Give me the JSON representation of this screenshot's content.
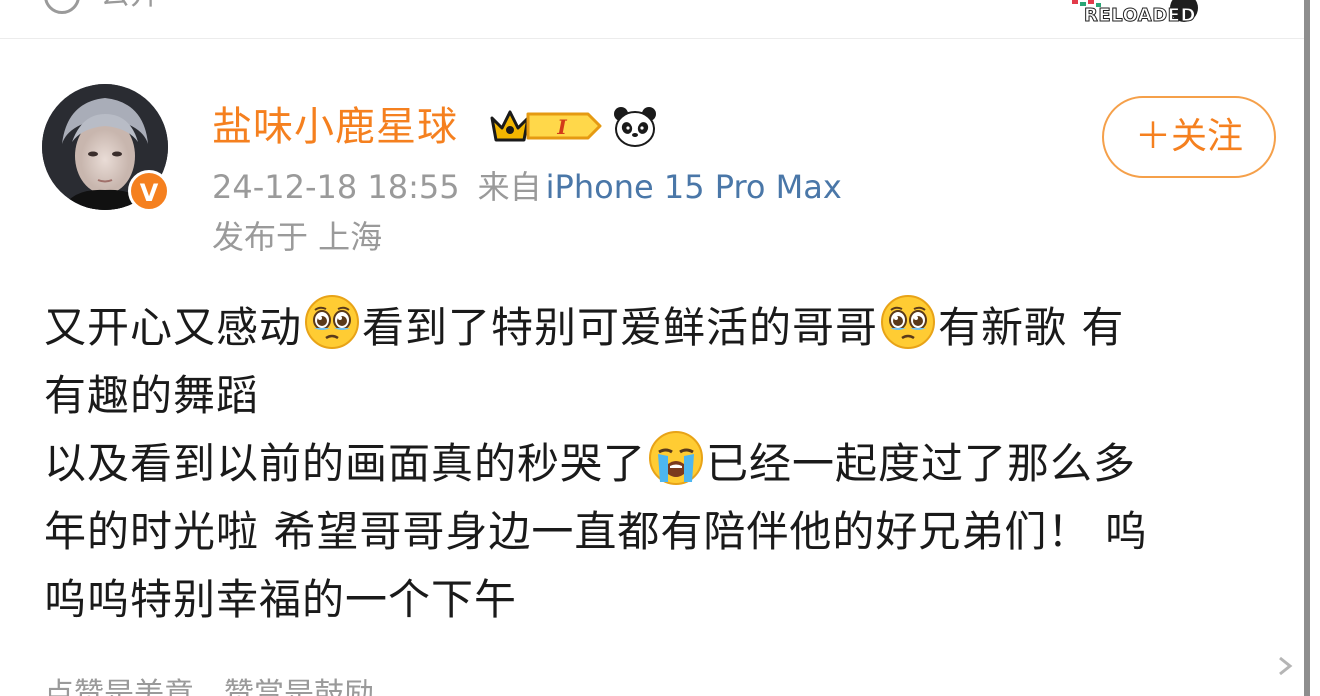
{
  "top_strip": {
    "partial_text": "公开",
    "badge_text": "RELOADED"
  },
  "header": {
    "username": "盐味小鹿星球",
    "vip_level": "I",
    "verified_mark": "V",
    "timestamp": "24-12-18 18:55",
    "from_label": "来自",
    "device": "iPhone 15 Pro Max",
    "location_label": "发布于 上海",
    "follow_button": "＋关注"
  },
  "post": {
    "line1_a": "又开心又感动",
    "line1_b": "看到了特别可爱鲜活的哥哥",
    "line1_c": "有新歌 有",
    "line2": "有趣的舞蹈",
    "line3_a": "以及看到以前的画面真的秒哭了",
    "line3_b": "已经一起度过了那么多",
    "line4": "年的时光啦 希望哥哥身边一直都有陪伴他的好兄弟们！ 呜",
    "line5": "呜呜特别幸福的一个下午"
  },
  "emojis": [
    "teary-face-icon",
    "teary-face-icon",
    "crying-face-icon"
  ],
  "bottom_strip": {
    "partial_text": "点赞是美意，赞赏是鼓励"
  },
  "colors": {
    "username": "#f5801f",
    "device_link": "#4a77a8",
    "meta_gray": "#9a9a9a",
    "text": "#1a1a1a"
  }
}
